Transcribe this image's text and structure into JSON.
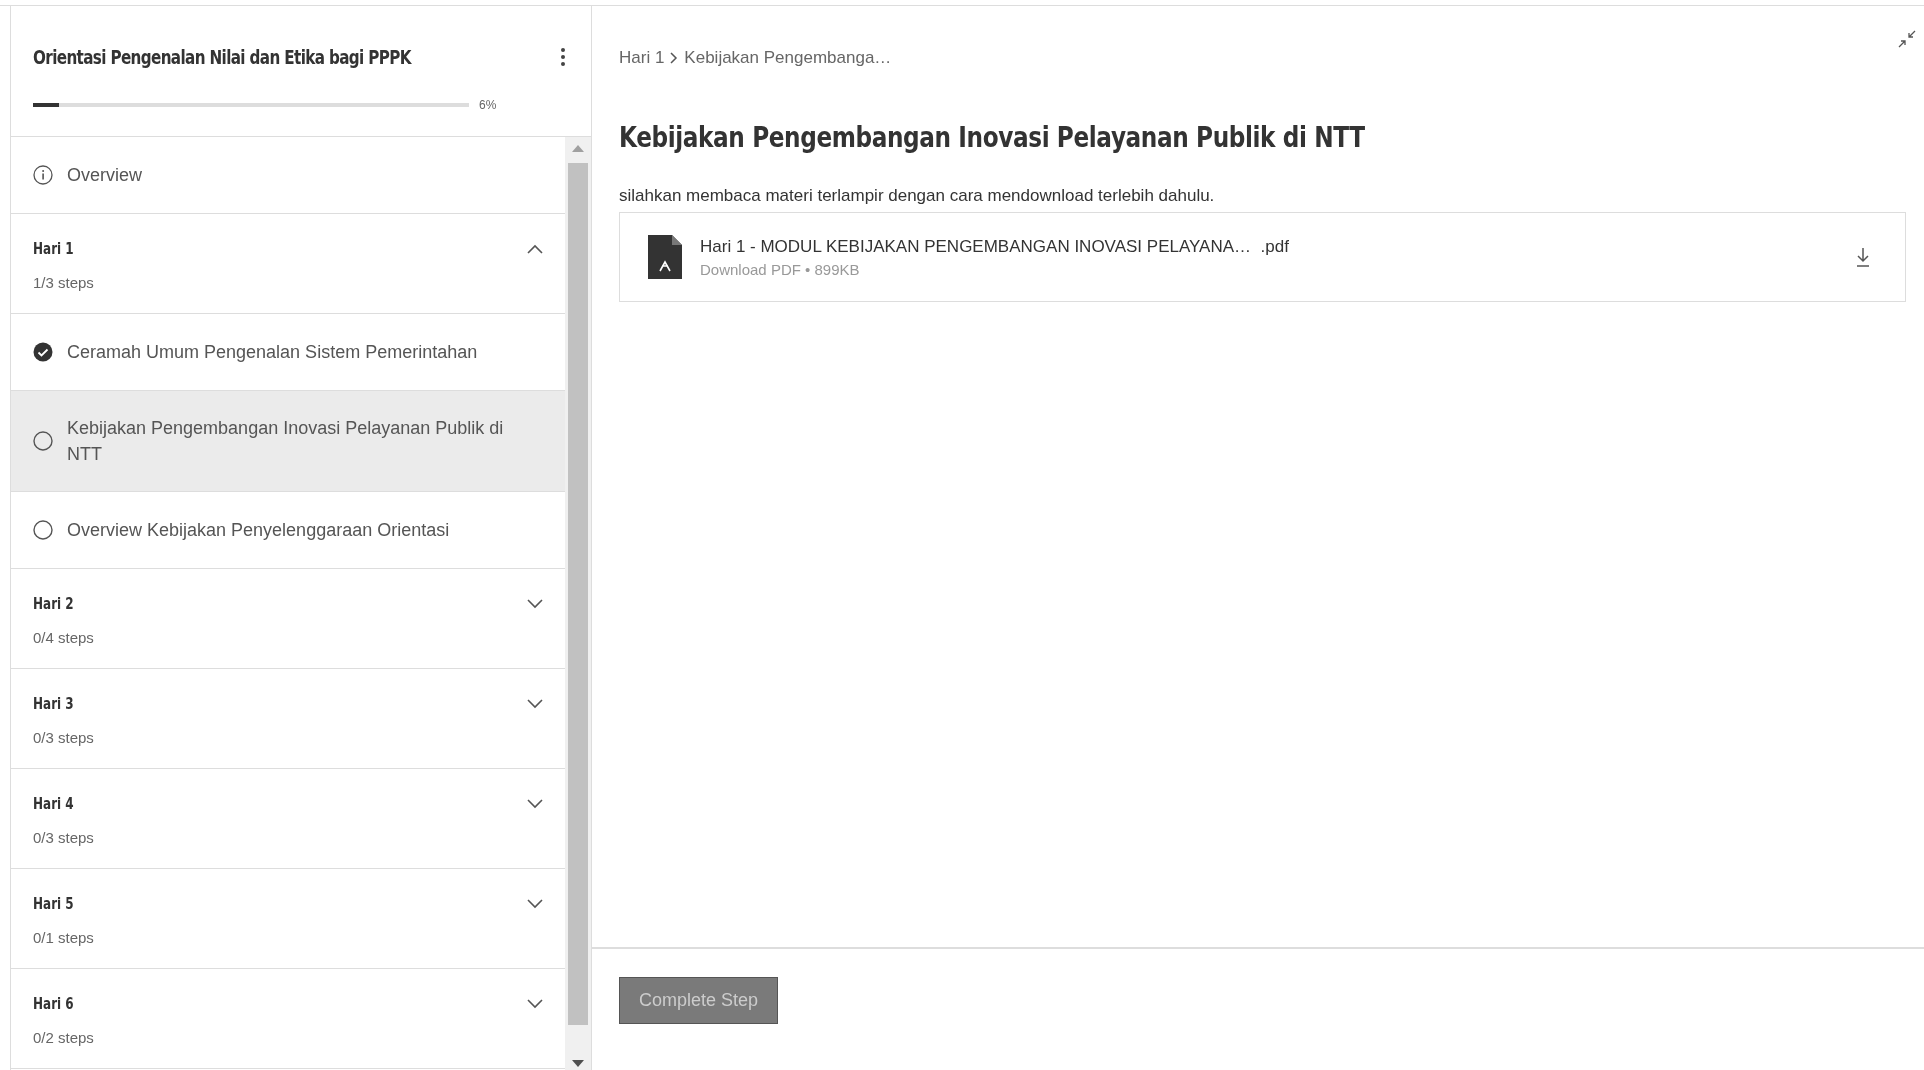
{
  "sidebar": {
    "course_title": "Orientasi Pengenalan Nilai dan Etika bagi PPPK",
    "progress": {
      "level": 0.06,
      "reading": "6%"
    },
    "overview": "Overview",
    "sections": [
      {
        "title": "Hari 1",
        "count": "1/3 steps",
        "expanded": true,
        "steps": [
          {
            "label": "Ceramah Umum Pengenalan Sistem Pemerintahan",
            "completed": true,
            "selected": false
          },
          {
            "label": "Kebijakan Pengembangan Inovasi Pelayanan Publik di NTT",
            "completed": false,
            "selected": true
          },
          {
            "label": "Overview Kebijakan Penyelenggaraan Orientasi",
            "completed": false,
            "selected": false
          }
        ]
      },
      {
        "title": "Hari 2",
        "count": "0/4 steps",
        "expanded": false
      },
      {
        "title": "Hari 3",
        "count": "0/3 steps",
        "expanded": false
      },
      {
        "title": "Hari 4",
        "count": "0/3 steps",
        "expanded": false
      },
      {
        "title": "Hari 5",
        "count": "0/1 steps",
        "expanded": false
      },
      {
        "title": "Hari 6",
        "count": "0/2 steps",
        "expanded": false
      }
    ]
  },
  "main": {
    "breadcrumb": [
      "Hari 1",
      "Kebijakan Pengembanga…"
    ],
    "heading": "Kebijakan Pengembangan Inovasi Pelayanan Publik di NTT",
    "description": "silahkan membaca materi terlampir dengan cara mendownload terlebih dahulu.",
    "file": {
      "name": "Hari 1 - MODUL KEBIJAKAN PENGEMBANGAN INOVASI PELAYANA…  .pdf",
      "meta": "Download PDF • 899KB"
    },
    "complete_button": {
      "label": "Complete Step",
      "disabled": true
    }
  }
}
